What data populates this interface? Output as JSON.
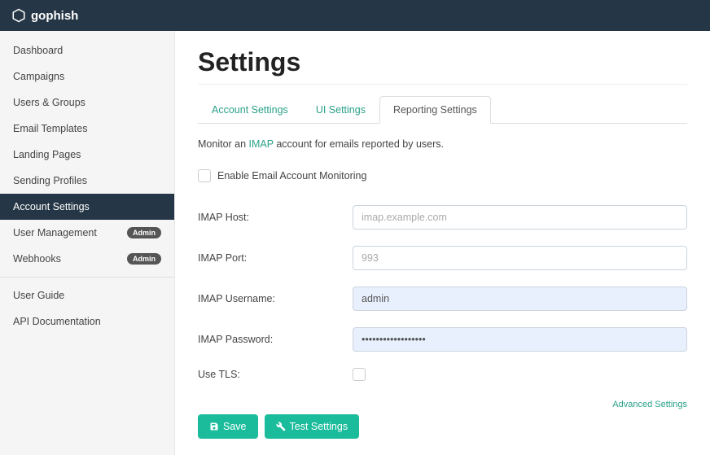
{
  "brand": {
    "name": "gophish"
  },
  "sidebar": {
    "items": [
      {
        "label": "Dashboard"
      },
      {
        "label": "Campaigns"
      },
      {
        "label": "Users & Groups"
      },
      {
        "label": "Email Templates"
      },
      {
        "label": "Landing Pages"
      },
      {
        "label": "Sending Profiles"
      },
      {
        "label": "Account Settings"
      },
      {
        "label": "User Management",
        "badge": "Admin"
      },
      {
        "label": "Webhooks",
        "badge": "Admin"
      }
    ],
    "secondary": [
      {
        "label": "User Guide"
      },
      {
        "label": "API Documentation"
      }
    ]
  },
  "page": {
    "title": "Settings",
    "tabs": [
      {
        "label": "Account Settings"
      },
      {
        "label": "UI Settings"
      },
      {
        "label": "Reporting Settings"
      }
    ],
    "description_prefix": "Monitor an ",
    "description_link": "IMAP",
    "description_suffix": " account for emails reported by users.",
    "enable_checkbox_label": "Enable Email Account Monitoring",
    "form": {
      "host_label": "IMAP Host:",
      "host_placeholder": "imap.example.com",
      "host_value": "",
      "port_label": "IMAP Port:",
      "port_placeholder": "993",
      "port_value": "",
      "user_label": "IMAP Username:",
      "user_value": "admin",
      "pass_label": "IMAP Password:",
      "pass_value": "••••••••••••••••••",
      "tls_label": "Use TLS:"
    },
    "advanced_label": "Advanced Settings",
    "save_label": "Save",
    "test_label": "Test Settings"
  }
}
